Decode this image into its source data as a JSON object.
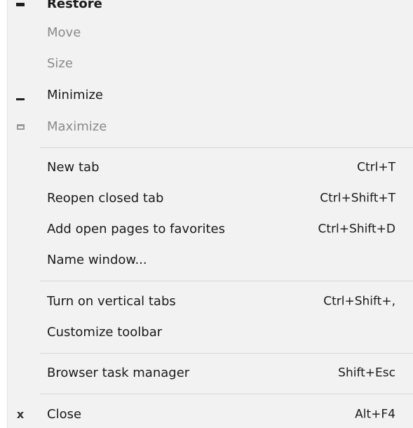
{
  "menu": {
    "restore": {
      "label": "Restore",
      "icon": "restore-icon"
    },
    "move": {
      "label": "Move"
    },
    "size": {
      "label": "Size"
    },
    "minimize": {
      "label": "Minimize",
      "icon": "minimize-icon"
    },
    "maximize": {
      "label": "Maximize",
      "icon": "maximize-icon"
    },
    "new_tab": {
      "label": "New tab",
      "shortcut": "Ctrl+T"
    },
    "reopen_closed_tab": {
      "label": "Reopen closed tab",
      "shortcut": "Ctrl+Shift+T"
    },
    "add_open_pages": {
      "label": "Add open pages to favorites",
      "shortcut": "Ctrl+Shift+D"
    },
    "name_window": {
      "label": "Name window..."
    },
    "vertical_tabs": {
      "label": "Turn on vertical tabs",
      "shortcut": "Ctrl+Shift+,"
    },
    "customize_toolbar": {
      "label": "Customize toolbar"
    },
    "task_manager": {
      "label": "Browser task manager",
      "shortcut": "Shift+Esc"
    },
    "close": {
      "label": "Close",
      "shortcut": "Alt+F4",
      "icon": "close-icon"
    }
  },
  "colors": {
    "menu_background": "#f2f2f2",
    "text": "#1a1a1a",
    "disabled_text": "#8a8a8a",
    "separator": "#d6d6d6"
  }
}
